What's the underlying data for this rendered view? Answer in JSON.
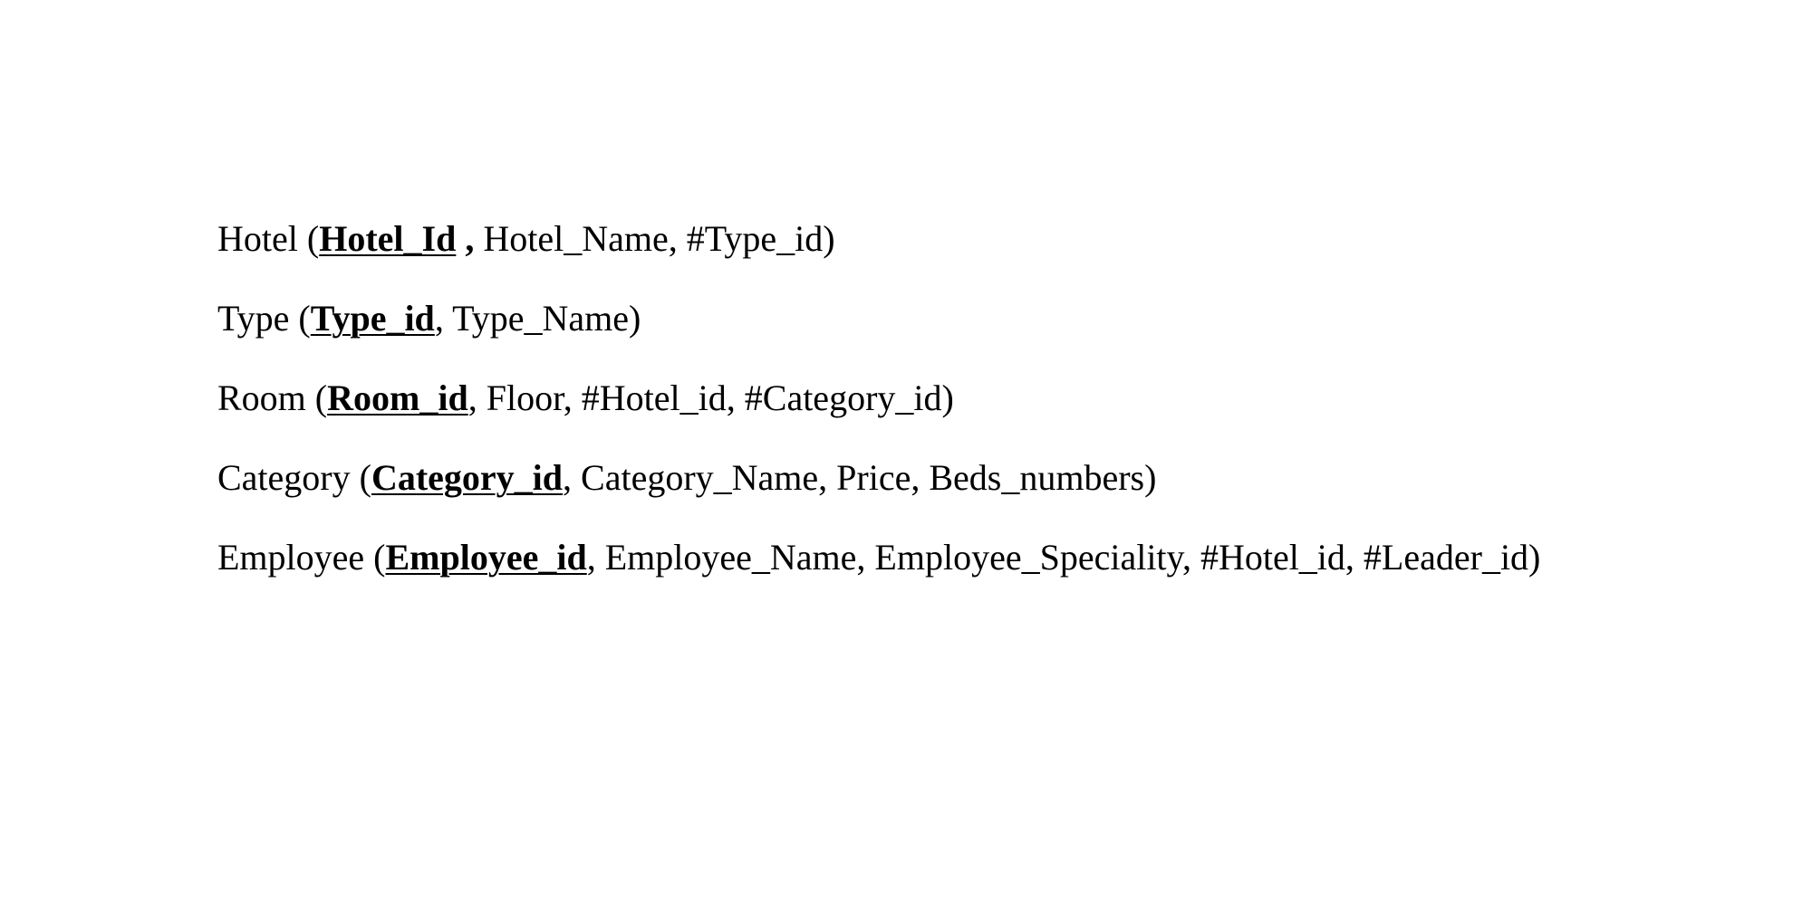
{
  "relations": {
    "hotel": {
      "name": "Hotel",
      "open": " (",
      "pk": "Hotel_Id",
      "sep": " ,",
      "rest": " Hotel_Name, #Type_id)"
    },
    "type": {
      "name": "Type",
      "open": " (",
      "pk": "Type_id",
      "rest": ", Type_Name)"
    },
    "room": {
      "name": "Room",
      "open": " (",
      "pk": "Room_id",
      "rest": ", Floor, #Hotel_id, #Category_id)"
    },
    "category": {
      "name": "Category",
      "open": " (",
      "pk": "Category_id",
      "rest": ", Category_Name, Price, Beds_numbers)"
    },
    "employee": {
      "name": "Employee",
      "open": " (",
      "pk": "Employee_id",
      "rest": ", Employee_Name, Employee_Speciality, #Hotel_id, #Leader_id)"
    }
  }
}
